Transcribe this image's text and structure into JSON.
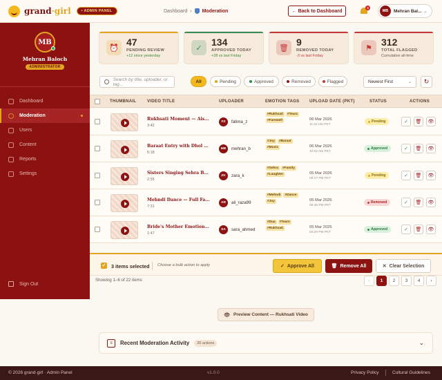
{
  "header": {
    "logo_main": "grand",
    "logo_sep": "·",
    "logo_accent": "girl",
    "admin_badge": "• ADMIN PANEL",
    "breadcrumb_root": "Dashboard",
    "breadcrumb_sep": "›",
    "breadcrumb_current": "Moderation",
    "back_button": "← Back to Dashboard",
    "notification_count": "3",
    "user_initials": "MB",
    "user_name": "Mehran Bal...",
    "user_chevron": "⌄"
  },
  "sidebar": {
    "initials": "MB",
    "name": "Mehran Baloch",
    "role": "ADMINISTRATOR",
    "items": [
      {
        "label": "Dashboard",
        "icon": "dashboard-icon"
      },
      {
        "label": "Moderation",
        "icon": "shield-icon",
        "active": true
      },
      {
        "label": "Users",
        "icon": "users-icon"
      },
      {
        "label": "Content",
        "icon": "content-icon"
      },
      {
        "label": "Reports",
        "icon": "reports-icon"
      },
      {
        "label": "Settings",
        "icon": "settings-icon"
      }
    ],
    "signout": "Sign Out"
  },
  "stats": [
    {
      "value": "47",
      "label": "PENDING REVIEW",
      "sub": "+12 since yesterday",
      "icon": "alarm-clock-icon",
      "glyph": "⏰",
      "color": "#e2a421",
      "sub_color": "#3a8a3a"
    },
    {
      "value": "134",
      "label": "APPROVED TODAY",
      "sub": "+28 vs last Friday",
      "icon": "check-icon",
      "glyph": "✓",
      "color": "#3a8a5a",
      "sub_color": "#3a8a3a"
    },
    {
      "value": "9",
      "label": "REMOVED TODAY",
      "sub": "-3 vs last Friday",
      "icon": "trash-icon",
      "glyph": "🗑",
      "color": "#c23a3a",
      "sub_color": "#c23a3a"
    },
    {
      "value": "312",
      "label": "TOTAL FLAGGED",
      "sub": "Cumulative all-time",
      "icon": "flag-icon",
      "glyph": "⚑",
      "color": "#c23a3a",
      "sub_color": "#6b5b50"
    }
  ],
  "filters": {
    "search_placeholder": "Search by title, uploader, or tag...",
    "pills": [
      {
        "label": "All",
        "active": true,
        "dot": ""
      },
      {
        "label": "Pending",
        "dot": "#e2a421"
      },
      {
        "label": "Approved",
        "dot": "#2f8a4c"
      },
      {
        "label": "Removed",
        "dot": "#8d1313"
      },
      {
        "label": "Flagged",
        "dot": "#c23a3a"
      }
    ],
    "sort_value": "Newest First",
    "sort_chevron": "⌄",
    "refresh_glyph": "↻"
  },
  "table": {
    "headers": [
      "THUMBNAIL",
      "VIDEO TITLE",
      "UPLOADER",
      "EMOTION TAGS",
      "UPLOAD DATE (PKT)",
      "STATUS",
      "ACTIONS"
    ],
    "rows": [
      {
        "title": "Rukhsati Moment — Aisha's Farewell",
        "duration": "3:42",
        "initials": "FZ",
        "uploader": "fatima_z",
        "tags": [
          "#Rukhsati",
          "#Tears",
          "#Farewell"
        ],
        "date": "06 Mar 2026",
        "time": "11:32 AM PKT",
        "status": "Pending"
      },
      {
        "title": "Baraat Entry with Dhol & Shehnai",
        "duration": "5:18",
        "initials": "MB",
        "uploader": "mehran_b",
        "tags": [
          "#Joy",
          "#Baraat",
          "#Music"
        ],
        "date": "06 Mar 2026",
        "time": "10:02 AM PKT",
        "status": "Approved"
      },
      {
        "title": "Sisters Singing Sehra Before Baraat",
        "duration": "2:55",
        "initials": "ZK",
        "uploader": "zara_k",
        "tags": [
          "#Sehra",
          "#Family",
          "#Laughter"
        ],
        "date": "05 Mar 2026",
        "time": "09:17 PM PKT",
        "status": "Pending"
      },
      {
        "title": "Mehndi Dance — Full Family Performance",
        "duration": "7:31",
        "initials": "AR",
        "uploader": "ali_raza99",
        "tags": [
          "#Mehndi",
          "#Dance",
          "#Joy"
        ],
        "date": "05 Mar 2026",
        "time": "06:45 PM PKT",
        "status": "Removed"
      },
      {
        "title": "Bride's Mother Emotional Dua",
        "duration": "1:47",
        "initials": "SA",
        "uploader": "sara_ahmed",
        "tags": [
          "#Dua",
          "#Tears",
          "#Rukhsati"
        ],
        "date": "05 Mar 2026",
        "time": "04:20 PM PKT",
        "status": "Approved"
      }
    ],
    "action_glyphs": {
      "approve": "✓",
      "delete": "🗑",
      "view": "👁"
    }
  },
  "bulk": {
    "selected": "3 items selected",
    "hint": "Choose a bulk action to apply",
    "approve": "Approve All",
    "remove": "Remove All",
    "clear": "Clear Selection",
    "check_glyph": "✓"
  },
  "pagination": {
    "showing": "Showing 1–6 of 22 items",
    "prev": "‹",
    "pages": [
      "1",
      "2",
      "3",
      "4"
    ],
    "next": "›"
  },
  "preview_button": "Preview Content — Rukhsati Video",
  "activity": {
    "title": "Recent Moderation Activity",
    "badge": "20 actions",
    "chevron": "⌄"
  },
  "footer": {
    "copyright": "© 2026 grand·girl · Admin Panel",
    "version": "v1.0.0",
    "privacy": "Privacy Policy",
    "guidelines": "Cultural Guidelines"
  },
  "colors": {
    "brand": "#8d1313",
    "accent": "#e2a421",
    "background": "#fbf7f1"
  }
}
